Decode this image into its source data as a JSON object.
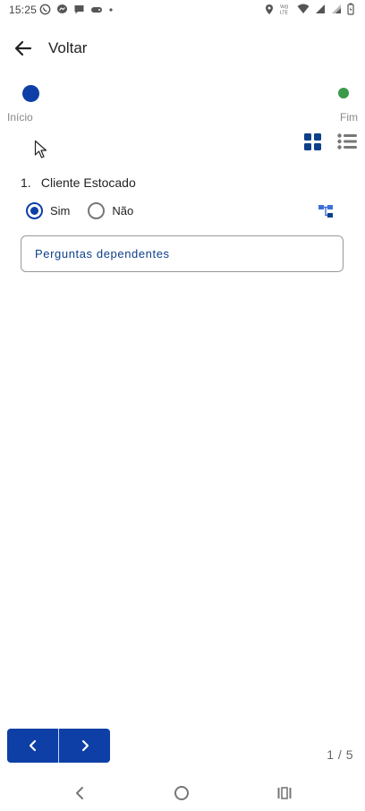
{
  "status_bar": {
    "time": "15:25",
    "left_icons": [
      "whatsapp-icon",
      "messenger-icon",
      "chat-icon",
      "game-controller-icon",
      "dot-icon"
    ],
    "right_icons": [
      "location-icon",
      "volte-lte-icon",
      "wifi-icon",
      "signal-icon",
      "signal-secondary-icon",
      "battery-charging-icon"
    ],
    "network_label": "Vo)) LTE"
  },
  "app_bar": {
    "title": "Voltar"
  },
  "progress": {
    "start_label": "Início",
    "end_label": "Fim",
    "start_color": "#0d3fa6",
    "end_color": "#3a9a48"
  },
  "question": {
    "number": "1.",
    "title": "Cliente Estocado",
    "options": [
      {
        "label": "Sim",
        "selected": true
      },
      {
        "label": "Não",
        "selected": false
      }
    ],
    "dependent_button_label": "Perguntas dependentes"
  },
  "footer": {
    "page_indicator": "1 / 5",
    "accent": "#0d3fa6"
  }
}
